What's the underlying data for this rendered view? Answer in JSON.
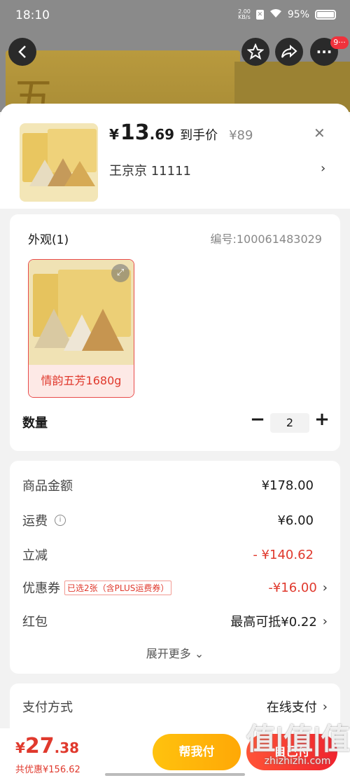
{
  "status_bar": {
    "time": "18:10",
    "net_speed": "2.00\nKB/s",
    "battery": "95%"
  },
  "nav": {
    "back": "‹",
    "favorite": "☆",
    "share": "↪",
    "more": "···",
    "more_badge": "9···"
  },
  "background": {
    "glyph": "五"
  },
  "product": {
    "currency": "¥",
    "price_int": "13",
    "price_dec": ".69",
    "price_label": "到手价",
    "original_price": "¥89",
    "address": "王京京  11111",
    "close": "✕",
    "addr_arrow": "›"
  },
  "appearance": {
    "title": "外观(1)",
    "code": "编号:100061483029",
    "variant_label": "情韵五芳1680g",
    "quantity_label": "数量",
    "quantity": "2",
    "minus": "−",
    "plus": "+"
  },
  "costs": {
    "goods_label": "商品金额",
    "goods_value": "¥178.00",
    "shipping_label": "运费",
    "shipping_value": "¥6.00",
    "discount_label": "立减",
    "discount_value": "- ¥140.62",
    "coupon_label": "优惠券",
    "coupon_tag": "已选2张（含PLUS运费券）",
    "coupon_value": "-¥16.00",
    "redpacket_label": "红包",
    "redpacket_value": "最高可抵¥0.22",
    "expand": "展开更多 ⌄"
  },
  "payment": {
    "label": "支付方式",
    "value": "在线支付"
  },
  "footer": {
    "currency": "¥",
    "total_int": "27",
    "total_dec": ".38",
    "saved": "共优惠¥156.62",
    "help_pay": "帮我付",
    "self_pay": "自己付"
  },
  "watermark": {
    "main": "值|值|值",
    "sub": "zhizhizhi.com"
  }
}
